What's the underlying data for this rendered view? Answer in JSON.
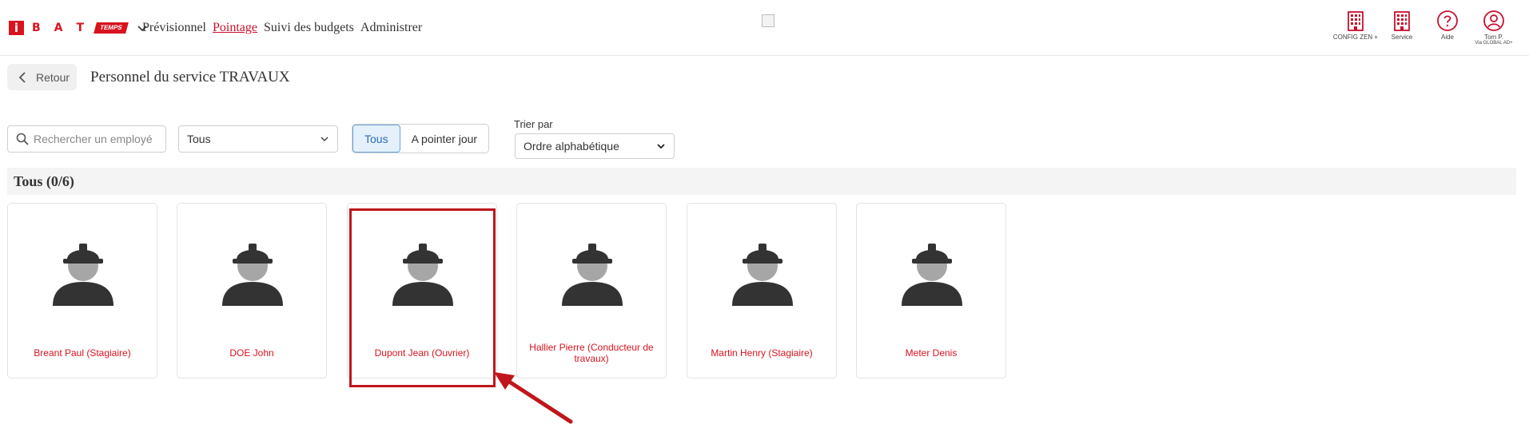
{
  "header": {
    "logo": {
      "i": "i",
      "letters": [
        "B",
        "A",
        "T"
      ],
      "tag": "TEMPS"
    },
    "nav": [
      "Prévisionnel",
      "Pointage",
      "Suivi des budgets",
      "Administrer"
    ],
    "active_nav": "Pointage",
    "right": {
      "config": "CONFIG ZEN +",
      "service": "Service",
      "aide": "Aide",
      "user": "Tom P.",
      "user_sub": "Via GLOBAL AD+"
    }
  },
  "page": {
    "back_label": "Retour",
    "title": "Personnel du service TRAVAUX"
  },
  "filters": {
    "search_placeholder": "Rechercher un employé",
    "category_value": "Tous",
    "toggle": [
      "Tous",
      "A pointer jour"
    ],
    "toggle_selected": "Tous",
    "sort_label": "Trier par",
    "sort_value": "Ordre alphabétique"
  },
  "group": {
    "title": "Tous (0/6)"
  },
  "employees": [
    "Breant Paul (Stagiaire)",
    "DOE John",
    "Dupont Jean (Ouvrier)",
    "Hallier Pierre (Conducteur de travaux)",
    "Martin Henry (Stagiaire)",
    "Meter Denis"
  ],
  "colors": {
    "brand": "#d9131e",
    "selected_toggle": "#e4f0fb",
    "highlight": "#c0161c"
  }
}
